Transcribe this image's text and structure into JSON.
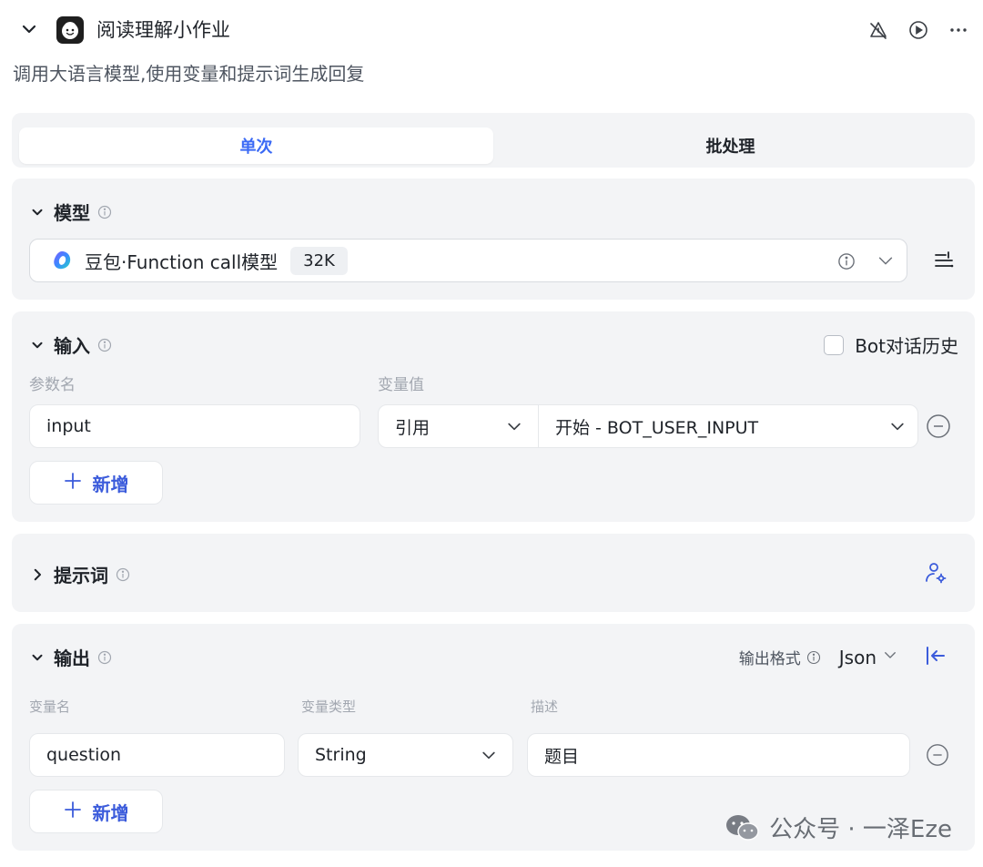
{
  "header": {
    "title": "阅读理解小作业",
    "icons": [
      "chevron-down-icon",
      "bot-avatar-icon",
      "alert-off-icon",
      "play-icon",
      "more-icon"
    ]
  },
  "subtitle": "调用大语言模型,使用变量和提示词生成回复",
  "tabs": [
    {
      "label": "单次",
      "active": true
    },
    {
      "label": "批处理",
      "active": false
    }
  ],
  "model": {
    "title": "模型",
    "name": "豆包·Function call模型",
    "tag": "32K"
  },
  "input": {
    "title": "输入",
    "bot_history_label": "Bot对话历史",
    "col_param": "参数名",
    "col_value": "变量值",
    "row": {
      "param": "input",
      "ref_type": "引用",
      "ref_value": "开始 - BOT_USER_INPUT"
    },
    "add_label": "新增"
  },
  "prompt": {
    "title": "提示词"
  },
  "output": {
    "title": "输出",
    "format_label": "输出格式",
    "format_value": "Json",
    "col_name": "变量名",
    "col_type": "变量类型",
    "col_desc": "描述",
    "row": {
      "name": "question",
      "type": "String",
      "desc": "题目"
    },
    "add_label": "新增"
  },
  "watermark": "公众号 · 一泽Eze",
  "colors": {
    "accent": "#3b6af5",
    "card_bg": "#f3f4f6",
    "add_text": "#3b5bdb"
  }
}
